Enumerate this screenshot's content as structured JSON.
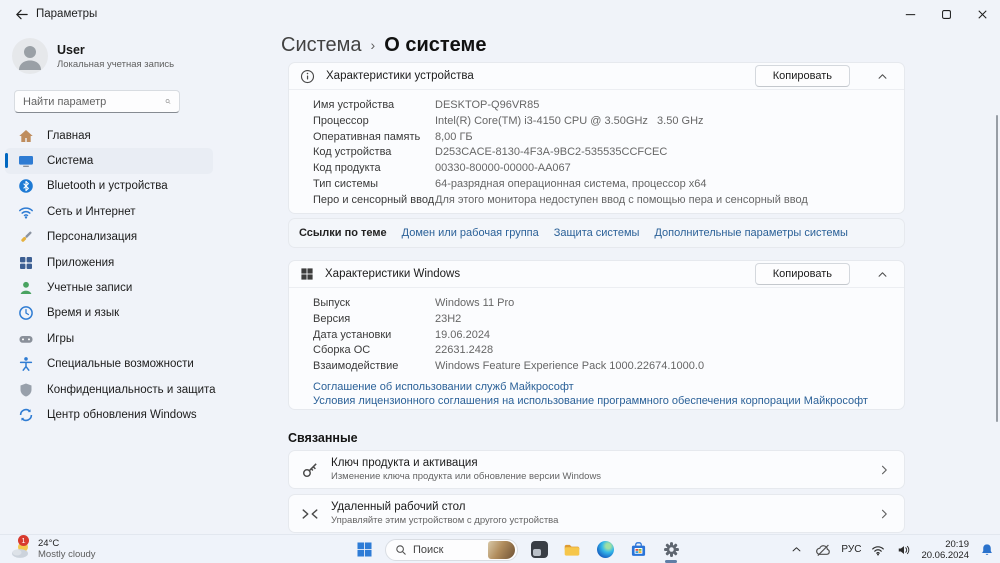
{
  "colors": {
    "accent": "#0067c0",
    "link": "#2b6198",
    "page_bg": "#f0f3f9",
    "card_bg": "#fbfcfe",
    "badge_red": "#d83a2e"
  },
  "window": {
    "title": "Параметры"
  },
  "sidebar": {
    "user": {
      "name": "User",
      "account_type": "Локальная учетная запись"
    },
    "search": {
      "placeholder": "Найти параметр"
    },
    "items": [
      {
        "label": "Главная"
      },
      {
        "label": "Система",
        "selected": true
      },
      {
        "label": "Bluetooth и устройства"
      },
      {
        "label": "Сеть и Интернет"
      },
      {
        "label": "Персонализация"
      },
      {
        "label": "Приложения"
      },
      {
        "label": "Учетные записи"
      },
      {
        "label": "Время и язык"
      },
      {
        "label": "Игры"
      },
      {
        "label": "Специальные возможности"
      },
      {
        "label": "Конфиденциальность и защита"
      },
      {
        "label": "Центр обновления Windows"
      }
    ]
  },
  "main": {
    "breadcrumb": {
      "parent": "Система",
      "separator": "›",
      "current": "О системе"
    },
    "device_card": {
      "title": "Характеристики устройства",
      "copy_label": "Копировать",
      "rows": [
        {
          "label": "Имя устройства",
          "value": "DESKTOP-Q96VR85"
        },
        {
          "label": "Процессор",
          "value": "Intel(R) Core(TM) i3-4150 CPU @ 3.50GHz   3.50 GHz"
        },
        {
          "label": "Оперативная память",
          "value": "8,00 ГБ"
        },
        {
          "label": "Код устройства",
          "value": "D253CACE-8130-4F3A-9BC2-535535CCFCEC"
        },
        {
          "label": "Код продукта",
          "value": "00330-80000-00000-AA067"
        },
        {
          "label": "Тип системы",
          "value": "64-разрядная операционная система, процессор x64"
        },
        {
          "label": "Перо и сенсорный ввод",
          "value": "Для этого монитора недоступен ввод с помощью пера и сенсорный ввод"
        }
      ]
    },
    "related_links_bar": {
      "label": "Ссылки по теме",
      "links": [
        "Домен или рабочая группа",
        "Защита системы",
        "Дополнительные параметры системы"
      ]
    },
    "windows_card": {
      "title": "Характеристики Windows",
      "copy_label": "Копировать",
      "rows": [
        {
          "label": "Выпуск",
          "value": "Windows 11 Pro"
        },
        {
          "label": "Версия",
          "value": "23H2"
        },
        {
          "label": "Дата установки",
          "value": "19.06.2024"
        },
        {
          "label": "Сборка ОС",
          "value": "22631.2428"
        },
        {
          "label": "Взаимодействие",
          "value": "Windows Feature Experience Pack 1000.22674.1000.0"
        }
      ],
      "links": [
        "Соглашение об использовании служб Майкрософт",
        "Условия лицензионного соглашения на использование программного обеспечения корпорации Майкрософт"
      ]
    },
    "related_section": {
      "title": "Связанные",
      "items": [
        {
          "title": "Ключ продукта и активация",
          "subtitle": "Изменение ключа продукта или обновление версии Windows"
        },
        {
          "title": "Удаленный рабочий стол",
          "subtitle": "Управляйте этим устройством с другого устройства"
        }
      ]
    }
  },
  "taskbar": {
    "weather": {
      "temp": "24°C",
      "condition": "Mostly cloudy",
      "badge": "1"
    },
    "search_label": "Поиск",
    "tray": {
      "language": "РУС",
      "time": "20:19",
      "date": "20.06.2024"
    }
  }
}
